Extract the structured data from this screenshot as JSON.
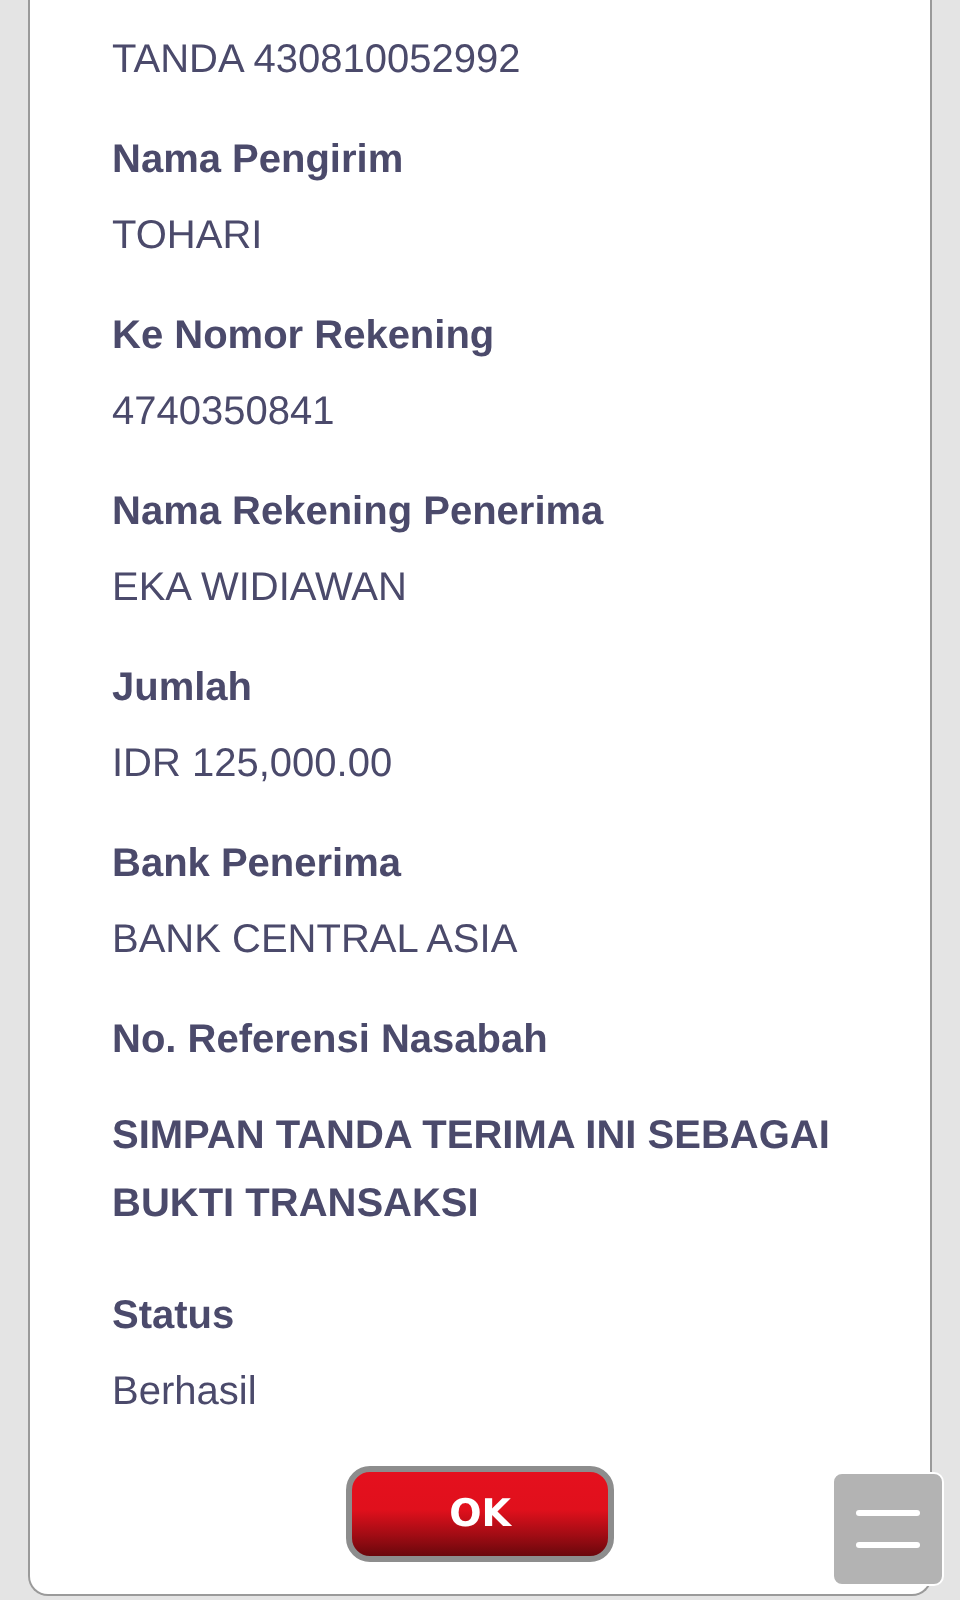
{
  "receipt": {
    "items": [
      {
        "kind": "value",
        "value": "TANDA 430810052992"
      },
      {
        "kind": "field",
        "label": "Nama Pengirim",
        "value": "TOHARI"
      },
      {
        "kind": "field",
        "label": "Ke Nomor Rekening",
        "value": "4740350841"
      },
      {
        "kind": "field",
        "label": "Nama Rekening Penerima",
        "value": "EKA WIDIAWAN"
      },
      {
        "kind": "field",
        "label": "Jumlah",
        "value": "IDR 125,000.00"
      },
      {
        "kind": "field",
        "label": "Bank Penerima",
        "value": "BANK CENTRAL ASIA"
      },
      {
        "kind": "label",
        "label": "No. Referensi Nasabah"
      },
      {
        "kind": "note",
        "label": "SIMPAN TANDA TERIMA INI SEBAGAI BUKTI TRANSAKSI"
      },
      {
        "kind": "field",
        "label": "Status",
        "value": "Berhasil"
      }
    ]
  },
  "ok_button": "OK"
}
